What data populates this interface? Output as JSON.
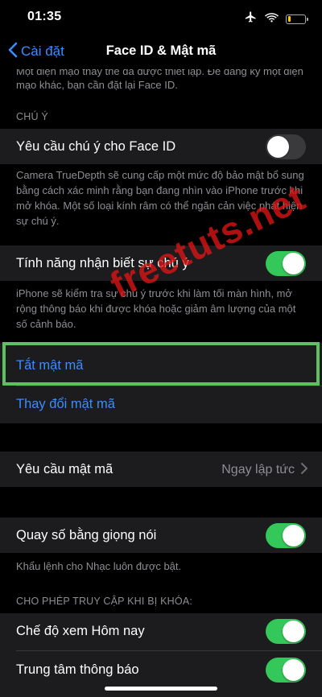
{
  "status_bar": {
    "time": "01:35",
    "icons": [
      "airplane-icon",
      "wifi-icon",
      "battery-icon"
    ],
    "battery_level": 0.2,
    "battery_color": "#f5c518"
  },
  "nav": {
    "back_label": "Cài đặt",
    "title": "Face ID & Mật mã"
  },
  "intro_text": "Một diện mạo thay thế đã được thiết lập. Để đăng ký một diện mạo khác, bạn cần đặt lại Face ID.",
  "attention": {
    "header": "CHÚ Ý",
    "require_label": "Yêu cầu chú ý cho Face ID",
    "require_on": false,
    "require_footer": "Camera TrueDepth sẽ cung cấp một mức độ bảo mật bổ sung bằng cách xác minh rằng bạn đang nhìn vào iPhone trước khi mở khóa. Một số loại kính râm có thể ngăn cản việc phát hiện sự chú ý.",
    "aware_label": "Tính năng nhận biết sự chú ý",
    "aware_on": true,
    "aware_footer": "iPhone sẽ kiểm tra sự chú ý trước khi làm tối màn hình, mở rộng thông báo khi được khóa hoặc giảm âm lượng của một số cảnh báo."
  },
  "passcode": {
    "turn_off": "Tắt mật mã",
    "change": "Thay đổi mật mã",
    "require_label": "Yêu cầu mật mã",
    "require_value": "Ngay lập tức"
  },
  "voice_dial": {
    "label": "Quay số bằng giọng nói",
    "on": true,
    "footer": "Khẩu lệnh cho Nhạc luôn được bật."
  },
  "locked_access": {
    "header": "CHO PHÉP TRUY CẬP KHI BỊ KHÓA:",
    "items": [
      {
        "label": "Chế độ xem Hôm nay",
        "on": true
      },
      {
        "label": "Trung tâm thông báo",
        "on": true
      }
    ]
  },
  "watermark": "freetuts.net",
  "colors": {
    "accent": "#3b8cff",
    "switch_on": "#34c759",
    "highlight": "#5ec05e",
    "watermark": "#dc1414"
  }
}
